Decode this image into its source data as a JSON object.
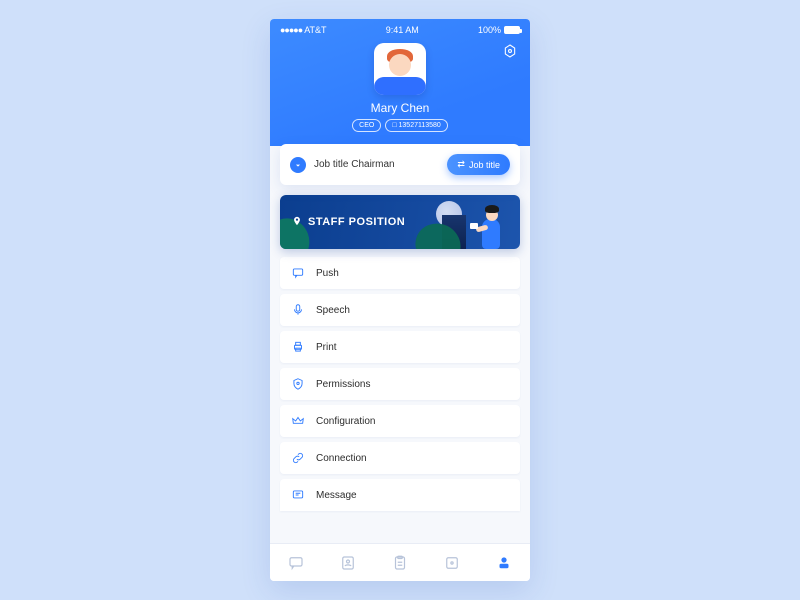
{
  "status": {
    "carrier": "AT&T",
    "time": "9:41 AM",
    "battery": "100%"
  },
  "user": {
    "name": "Mary Chen",
    "role_badge": "CEO",
    "phone_badge": "□ 13527113580"
  },
  "job": {
    "label": "Job title Chairman",
    "button": "Job title"
  },
  "banner": {
    "title": "STAFF POSITION"
  },
  "menu": [
    {
      "label": "Push"
    },
    {
      "label": "Speech"
    },
    {
      "label": "Print"
    },
    {
      "label": "Permissions"
    },
    {
      "label": "Configuration"
    },
    {
      "label": "Connection"
    },
    {
      "label": "Message"
    }
  ]
}
